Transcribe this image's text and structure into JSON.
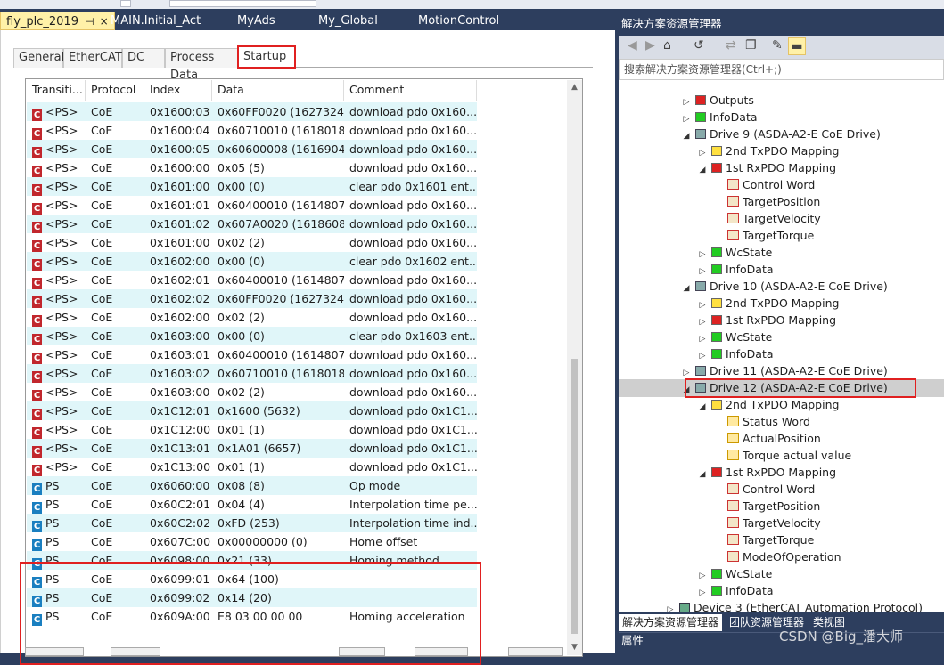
{
  "doc_tabs": [
    {
      "label": "fly_plc_2019",
      "active": true,
      "pin": "⊣",
      "close": "×"
    },
    {
      "label": "MAIN.Initial_Act"
    },
    {
      "label": "MyAds"
    },
    {
      "label": "My_Global"
    },
    {
      "label": "MotionControl"
    }
  ],
  "sub_tabs": [
    "General",
    "EtherCAT",
    "DC",
    "Process Data",
    "Startup"
  ],
  "grid": {
    "columns": [
      "Transiti...",
      "Protocol",
      "Index",
      "Data",
      "Comment"
    ],
    "rows": [
      [
        "C",
        "<PS>",
        "CoE",
        "0x1600:03",
        "0x60FF0020 (1627324...",
        "download pdo 0x160..."
      ],
      [
        "C",
        "<PS>",
        "CoE",
        "0x1600:04",
        "0x60710010 (1618018...",
        "download pdo 0x160..."
      ],
      [
        "C",
        "<PS>",
        "CoE",
        "0x1600:05",
        "0x60600008 (1616904...",
        "download pdo 0x160..."
      ],
      [
        "C",
        "<PS>",
        "CoE",
        "0x1600:00",
        "0x05 (5)",
        "download pdo 0x160..."
      ],
      [
        "C",
        "<PS>",
        "CoE",
        "0x1601:00",
        "0x00 (0)",
        "clear pdo 0x1601 ent..."
      ],
      [
        "C",
        "<PS>",
        "CoE",
        "0x1601:01",
        "0x60400010 (1614807...",
        "download pdo 0x160..."
      ],
      [
        "C",
        "<PS>",
        "CoE",
        "0x1601:02",
        "0x607A0020 (1618608...",
        "download pdo 0x160..."
      ],
      [
        "C",
        "<PS>",
        "CoE",
        "0x1601:00",
        "0x02 (2)",
        "download pdo 0x160..."
      ],
      [
        "C",
        "<PS>",
        "CoE",
        "0x1602:00",
        "0x00 (0)",
        "clear pdo 0x1602 ent..."
      ],
      [
        "C",
        "<PS>",
        "CoE",
        "0x1602:01",
        "0x60400010 (1614807...",
        "download pdo 0x160..."
      ],
      [
        "C",
        "<PS>",
        "CoE",
        "0x1602:02",
        "0x60FF0020 (1627324...",
        "download pdo 0x160..."
      ],
      [
        "C",
        "<PS>",
        "CoE",
        "0x1602:00",
        "0x02 (2)",
        "download pdo 0x160..."
      ],
      [
        "C",
        "<PS>",
        "CoE",
        "0x1603:00",
        "0x00 (0)",
        "clear pdo 0x1603 ent..."
      ],
      [
        "C",
        "<PS>",
        "CoE",
        "0x1603:01",
        "0x60400010 (1614807...",
        "download pdo 0x160..."
      ],
      [
        "C",
        "<PS>",
        "CoE",
        "0x1603:02",
        "0x60710010 (1618018...",
        "download pdo 0x160..."
      ],
      [
        "C",
        "<PS>",
        "CoE",
        "0x1603:00",
        "0x02 (2)",
        "download pdo 0x160..."
      ],
      [
        "C",
        "<PS>",
        "CoE",
        "0x1C12:01",
        "0x1600 (5632)",
        "download pdo 0x1C1..."
      ],
      [
        "C",
        "<PS>",
        "CoE",
        "0x1C12:00",
        "0x01 (1)",
        "download pdo 0x1C1..."
      ],
      [
        "C",
        "<PS>",
        "CoE",
        "0x1C13:01",
        "0x1A01 (6657)",
        "download pdo 0x1C1..."
      ],
      [
        "C",
        "<PS>",
        "CoE",
        "0x1C13:00",
        "0x01 (1)",
        "download pdo 0x1C1..."
      ],
      [
        "C",
        "PS",
        "CoE",
        "0x6060:00",
        "0x08 (8)",
        "Op mode"
      ],
      [
        "C",
        "PS",
        "CoE",
        "0x60C2:01",
        "0x04 (4)",
        "Interpolation time pe..."
      ],
      [
        "C",
        "PS",
        "CoE",
        "0x60C2:02",
        "0xFD (253)",
        "Interpolation time ind..."
      ],
      [
        "C",
        "PS",
        "CoE",
        "0x607C:00",
        "0x00000000 (0)",
        "Home offset"
      ],
      [
        "C",
        "PS",
        "CoE",
        "0x6098:00",
        "0x21 (33)",
        "Homing method"
      ],
      [
        "C",
        "PS",
        "CoE",
        "0x6099:01",
        "0x64 (100)",
        ""
      ],
      [
        "C",
        "PS",
        "CoE",
        "0x6099:02",
        "0x14 (20)",
        ""
      ],
      [
        "C",
        "PS",
        "CoE",
        "0x609A:00",
        "E8 03 00 00 00",
        "Homing acceleration"
      ]
    ]
  },
  "solution": {
    "title": "解决方案资源管理器",
    "search_placeholder": "搜索解决方案资源管理器(Ctrl+;)",
    "tree": [
      {
        "label": "Outputs",
        "indent": 4,
        "arrow": "▷",
        "icon": "red"
      },
      {
        "label": "InfoData",
        "indent": 4,
        "arrow": "▷",
        "icon": "green"
      },
      {
        "label": "Drive 9 (ASDA-A2-E CoE Drive)",
        "indent": 4,
        "arrow": "◢",
        "icon": "drv"
      },
      {
        "label": "2nd TxPDO Mapping",
        "indent": 5,
        "arrow": "▷",
        "icon": "yellow"
      },
      {
        "label": "1st RxPDO Mapping",
        "indent": 5,
        "arrow": "◢",
        "icon": "red"
      },
      {
        "label": "Control Word",
        "indent": 6,
        "arrow": "",
        "icon": "varr"
      },
      {
        "label": "TargetPosition",
        "indent": 6,
        "arrow": "",
        "icon": "varr"
      },
      {
        "label": "TargetVelocity",
        "indent": 6,
        "arrow": "",
        "icon": "varr"
      },
      {
        "label": "TargetTorque",
        "indent": 6,
        "arrow": "",
        "icon": "varr"
      },
      {
        "label": "WcState",
        "indent": 5,
        "arrow": "▷",
        "icon": "green"
      },
      {
        "label": "InfoData",
        "indent": 5,
        "arrow": "▷",
        "icon": "green"
      },
      {
        "label": "Drive 10 (ASDA-A2-E CoE Drive)",
        "indent": 4,
        "arrow": "◢",
        "icon": "drv"
      },
      {
        "label": "2nd TxPDO Mapping",
        "indent": 5,
        "arrow": "▷",
        "icon": "yellow"
      },
      {
        "label": "1st RxPDO Mapping",
        "indent": 5,
        "arrow": "▷",
        "icon": "red"
      },
      {
        "label": "WcState",
        "indent": 5,
        "arrow": "▷",
        "icon": "green"
      },
      {
        "label": "InfoData",
        "indent": 5,
        "arrow": "▷",
        "icon": "green"
      },
      {
        "label": "Drive 11 (ASDA-A2-E CoE Drive)",
        "indent": 4,
        "arrow": "▷",
        "icon": "drv"
      },
      {
        "label": "Drive 12 (ASDA-A2-E CoE Drive)",
        "indent": 4,
        "arrow": "◢",
        "icon": "drv",
        "selected": true
      },
      {
        "label": "2nd TxPDO Mapping",
        "indent": 5,
        "arrow": "◢",
        "icon": "yellow"
      },
      {
        "label": "Status Word",
        "indent": 6,
        "arrow": "",
        "icon": "vary"
      },
      {
        "label": "ActualPosition",
        "indent": 6,
        "arrow": "",
        "icon": "vary"
      },
      {
        "label": "Torque actual value",
        "indent": 6,
        "arrow": "",
        "icon": "vary"
      },
      {
        "label": "1st RxPDO Mapping",
        "indent": 5,
        "arrow": "◢",
        "icon": "red"
      },
      {
        "label": "Control Word",
        "indent": 6,
        "arrow": "",
        "icon": "varr"
      },
      {
        "label": "TargetPosition",
        "indent": 6,
        "arrow": "",
        "icon": "varr"
      },
      {
        "label": "TargetVelocity",
        "indent": 6,
        "arrow": "",
        "icon": "varr"
      },
      {
        "label": "TargetTorque",
        "indent": 6,
        "arrow": "",
        "icon": "varr"
      },
      {
        "label": "ModeOfOperation",
        "indent": 6,
        "arrow": "",
        "icon": "varr"
      },
      {
        "label": "WcState",
        "indent": 5,
        "arrow": "▷",
        "icon": "green"
      },
      {
        "label": "InfoData",
        "indent": 5,
        "arrow": "▷",
        "icon": "green"
      },
      {
        "label": "Device 3 (EtherCAT Automation Protocol)",
        "indent": 3,
        "arrow": "▷",
        "icon": "dev"
      }
    ],
    "bottom_tabs": [
      "解决方案资源管理器",
      "团队资源管理器",
      "类视图"
    ],
    "properties_label": "属性"
  },
  "watermark": "CSDN @Big_潘大师"
}
